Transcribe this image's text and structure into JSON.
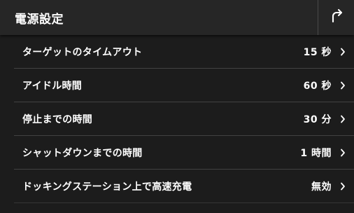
{
  "header": {
    "title": "電源設定",
    "back_icon": "return-arrow-icon"
  },
  "settings": [
    {
      "label": "ターゲットのタイムアウト",
      "value": "15 秒"
    },
    {
      "label": "アイドル時間",
      "value": "60 秒"
    },
    {
      "label": "停止までの時間",
      "value": "30 分"
    },
    {
      "label": "シャットダウンまでの時間",
      "value": "1 時間"
    },
    {
      "label": "ドッキングステーション上で高速充電",
      "value": "無効"
    }
  ],
  "colors": {
    "background": "#1c1c1c",
    "header": "#262626",
    "divider": "#424242",
    "text": "#ffffff"
  }
}
